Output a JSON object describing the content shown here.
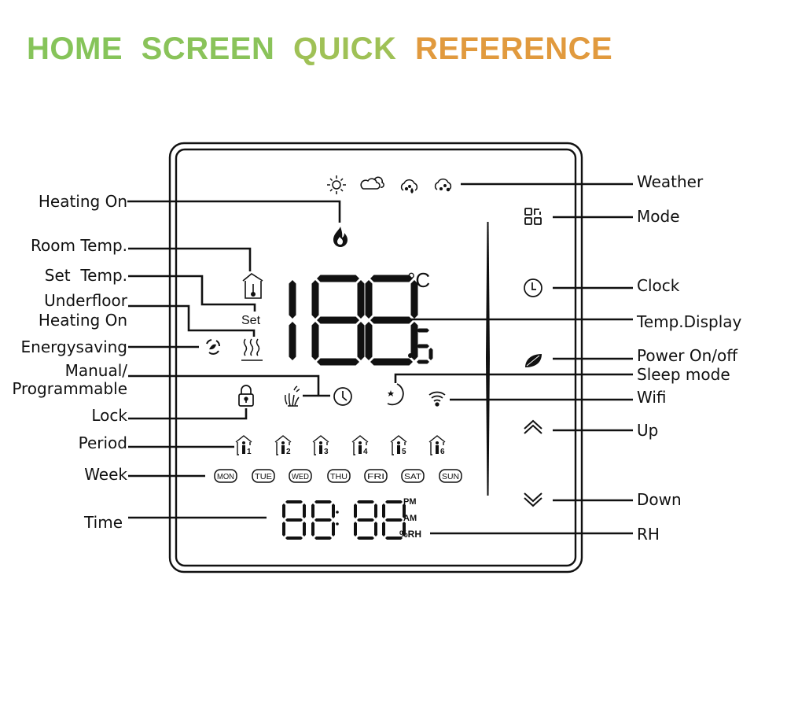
{
  "title": {
    "words": [
      {
        "text": "HOME",
        "color": "#86c45a"
      },
      {
        "text": "SCREEN",
        "color": "#8ac35a"
      },
      {
        "text": "QUICK",
        "color": "#9fc156"
      },
      {
        "text": "REFERENCE",
        "color": "#e19a3e"
      }
    ],
    "gradient_start": "#84c45b",
    "gradient_end": "#ef953a"
  },
  "left_labels": {
    "heating_on": "Heating On",
    "room_temp": "Room Temp.",
    "set_temp": "Set  Temp.",
    "underfloor_line1": "Underfloor",
    "underfloor_line2": "Heating On",
    "energysaving": "Energysaving",
    "manual_line1": "Manual/",
    "manual_line2": "Programmable",
    "lock": "Lock",
    "period": "Period",
    "week": "Week",
    "time": "Time"
  },
  "right_labels": {
    "weather": "Weather",
    "mode": "Mode",
    "clock": "Clock",
    "temp_display": "Temp.Display",
    "power": "Power On/off",
    "sleep": "Sleep mode",
    "wifi": "Wifi",
    "up": "Up",
    "down": "Down",
    "rh": "RH"
  },
  "display": {
    "temp_digits": "188",
    "temp_decimal": ".5",
    "temp_unit": "°C",
    "set_label": "Set",
    "time_digits": "88:88",
    "pm": "PM",
    "am": "AM",
    "rh": "%RH",
    "periods": [
      "1",
      "2",
      "3",
      "4",
      "5",
      "6"
    ],
    "weekdays": [
      "MON",
      "TUE",
      "WED",
      "THU",
      "FRI",
      "SAT",
      "SUN"
    ],
    "weather_icons": [
      "sun-icon",
      "cloudy-icon",
      "rain-icon",
      "snow-icon"
    ]
  }
}
